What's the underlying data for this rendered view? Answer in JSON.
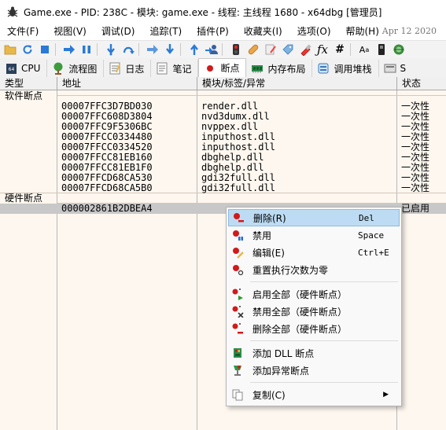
{
  "window": {
    "title": "Game.exe - PID: 238C - 模块: game.exe - 线程: 主线程 1680 - x64dbg [管理员]"
  },
  "menubar": {
    "items": [
      "文件(F)",
      "视图(V)",
      "调试(D)",
      "追踪(T)",
      "插件(P)",
      "收藏夹(I)",
      "选项(O)",
      "帮助(H)"
    ],
    "date": "Apr 12 2020"
  },
  "toolbar": {
    "icons": [
      "open-icon",
      "restart-icon",
      "stop-icon",
      "run-icon",
      "pause-icon",
      "step-into-icon",
      "step-over-icon",
      "trace-into-icon",
      "trace-over-icon",
      "execute-till-return-icon",
      "run-to-user-code-icon",
      "scylla-icon",
      "patch-icon",
      "comments-icon",
      "labels-icon",
      "bookmarks-icon",
      "functions-icon",
      "hash-icon",
      "font-icon",
      "pin-icon",
      "settings-icon"
    ]
  },
  "tabs": [
    {
      "label": "CPU",
      "icon": "cpu-icon"
    },
    {
      "label": "流程图",
      "icon": "graph-icon"
    },
    {
      "label": "日志",
      "icon": "log-icon"
    },
    {
      "label": "笔记",
      "icon": "notes-icon"
    },
    {
      "label": "断点",
      "icon": "breakpoint-icon",
      "active": true
    },
    {
      "label": "内存布局",
      "icon": "memory-icon"
    },
    {
      "label": "调用堆栈",
      "icon": "callstack-icon"
    },
    {
      "label": "S",
      "icon": "seh-icon"
    }
  ],
  "table": {
    "headers": [
      "类型",
      "地址",
      "模块/标签/异常",
      "状态"
    ],
    "sections": {
      "software": "软件断点",
      "hardware": "硬件断点"
    },
    "software_rows": [
      {
        "address": "00007FFC3D7BD030",
        "module": "render.dll",
        "state": "一次性"
      },
      {
        "address": "00007FFC608D3804",
        "module": "nvd3dumx.dll",
        "state": "一次性"
      },
      {
        "address": "00007FFC9F5306BC",
        "module": "nvppex.dll",
        "state": "一次性"
      },
      {
        "address": "00007FFCC0334480",
        "module": "inputhost.dll",
        "state": "一次性"
      },
      {
        "address": "00007FFCC0334520",
        "module": "inputhost.dll",
        "state": "一次性"
      },
      {
        "address": "00007FFCC81EB160",
        "module": "dbghelp.dll",
        "state": "一次性"
      },
      {
        "address": "00007FFCC81EB1F0",
        "module": "dbghelp.dll",
        "state": "一次性"
      },
      {
        "address": "00007FFCD68CA530",
        "module": "gdi32full.dll",
        "state": "一次性"
      },
      {
        "address": "00007FFCD68CA5B0",
        "module": "gdi32full.dll",
        "state": "一次性"
      }
    ],
    "hardware_rows": [
      {
        "address": "000002861B2DBEA4",
        "module": "",
        "state": "已启用"
      }
    ]
  },
  "context_menu": {
    "items": [
      {
        "label": "删除(R)",
        "shortcut": "Del",
        "icon": "delete-breakpoint-icon",
        "hover": true
      },
      {
        "label": "禁用",
        "shortcut": "Space",
        "icon": "disable-breakpoint-icon"
      },
      {
        "label": "编辑(E)",
        "shortcut": "Ctrl+E",
        "icon": "edit-breakpoint-icon"
      },
      {
        "label": "重置执行次数为零",
        "shortcut": "",
        "icon": "reset-hitcount-icon"
      },
      {
        "label": "启用全部（硬件断点）",
        "shortcut": "",
        "icon": "enable-all-icon"
      },
      {
        "label": "禁用全部（硬件断点）",
        "shortcut": "",
        "icon": "disable-all-icon"
      },
      {
        "label": "删除全部（硬件断点）",
        "shortcut": "",
        "icon": "delete-all-icon"
      },
      {
        "label": "添加 DLL 断点",
        "shortcut": "",
        "icon": "add-dll-breakpoint-icon"
      },
      {
        "label": "添加异常断点",
        "shortcut": "",
        "icon": "add-exception-breakpoint-icon"
      },
      {
        "label": "复制(C)",
        "shortcut": "",
        "icon": "copy-icon",
        "submenu": true
      }
    ]
  },
  "colors": {
    "grid_bg": "#fdf7ef",
    "selection": "#c8c8c8",
    "menu_hover": "#bddcf3",
    "breakpoint_red": "#d11a1a"
  }
}
